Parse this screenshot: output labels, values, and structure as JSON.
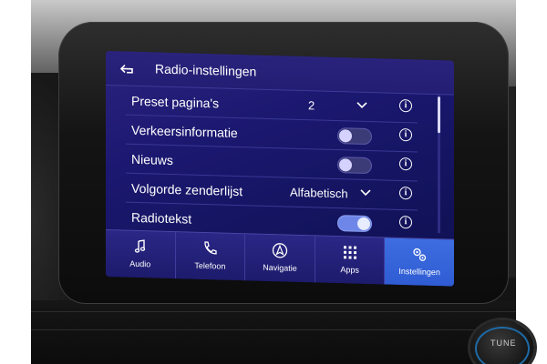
{
  "header": {
    "back_icon": "back-arrow-icon",
    "title": "Radio-instellingen"
  },
  "settings": [
    {
      "label": "Preset pagina's",
      "type": "dropdown",
      "value": "2",
      "info_icon": "info-icon"
    },
    {
      "label": "Verkeersinformatie",
      "type": "toggle",
      "on": false,
      "info_icon": "info-icon"
    },
    {
      "label": "Nieuws",
      "type": "toggle",
      "on": false,
      "info_icon": "info-icon"
    },
    {
      "label": "Volgorde zenderlijst",
      "type": "dropdown",
      "value": "Alfabetisch",
      "info_icon": "info-icon"
    },
    {
      "label": "Radiotekst",
      "type": "toggle",
      "on": true,
      "info_icon": "info-icon"
    }
  ],
  "navbar": [
    {
      "label": "Audio",
      "icon": "music-note-icon",
      "active": false
    },
    {
      "label": "Telefoon",
      "icon": "phone-icon",
      "active": false
    },
    {
      "label": "Navigatie",
      "icon": "navigation-arrow-icon",
      "active": false
    },
    {
      "label": "Apps",
      "icon": "apps-grid-icon",
      "active": false
    },
    {
      "label": "Instellingen",
      "icon": "settings-gears-icon",
      "active": true
    }
  ],
  "knob": {
    "label": "TUNE"
  },
  "colors": {
    "screen_bg": "#1b1870",
    "active_tab": "#3d6de0",
    "toggle_on": "#6d86e8"
  }
}
